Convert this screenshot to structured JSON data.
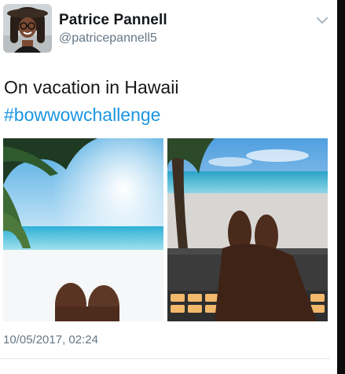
{
  "user": {
    "display_name": "Patrice Pannell",
    "handle": "@patricepannell5"
  },
  "tweet": {
    "text": "On vacation in Hawaii",
    "hashtag": "#bowwowchallenge",
    "timestamp": "10/05/2017, 02:24"
  },
  "media": [
    {
      "label": "beach-photo-fingers"
    },
    {
      "label": "laptop-wallpaper-photo-fingers"
    }
  ],
  "icons": {
    "menu": "chevron-down-icon"
  },
  "colors": {
    "name": "#14171a",
    "secondary_text": "#657786",
    "hashtag": "#1b95e0",
    "divider": "#e1e8ed"
  }
}
